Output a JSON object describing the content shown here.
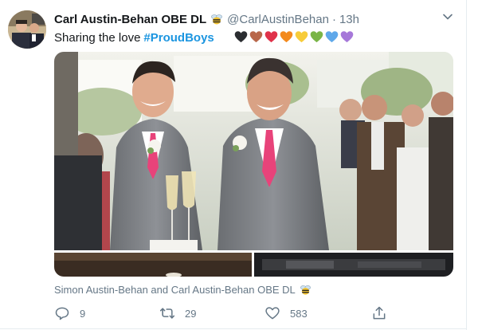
{
  "tweet": {
    "display_name": "Carl Austin-Behan OBE DL",
    "handle": "@CarlAustinBehan",
    "separator": "·",
    "time": "13h",
    "text": "Sharing the love",
    "hashtag": "#ProudBoys",
    "hearts": [
      {
        "name": "black-heart-icon",
        "color": "#2b2d31"
      },
      {
        "name": "brown-heart-icon",
        "color": "#b8674a"
      },
      {
        "name": "red-heart-icon",
        "color": "#e0324a"
      },
      {
        "name": "orange-heart-icon",
        "color": "#f38a1d"
      },
      {
        "name": "yellow-heart-icon",
        "color": "#f7cc3a"
      },
      {
        "name": "green-heart-icon",
        "color": "#7ab547"
      },
      {
        "name": "blue-heart-icon",
        "color": "#5fa8ea"
      },
      {
        "name": "purple-heart-icon",
        "color": "#a678d9"
      }
    ],
    "tagged_people": "Simon Austin-Behan and Carl Austin-Behan OBE DL",
    "actions": {
      "reply_count": "9",
      "retweet_count": "29",
      "like_count": "583"
    }
  },
  "colors": {
    "link": "#1b95e0",
    "secondary_text": "#657786",
    "primary_text": "#14171a"
  },
  "icons": {
    "badge": "bee-icon",
    "caret": "chevron-down-icon",
    "reply": "reply-icon",
    "retweet": "retweet-icon",
    "like": "heart-outline-icon",
    "share": "share-icon"
  }
}
